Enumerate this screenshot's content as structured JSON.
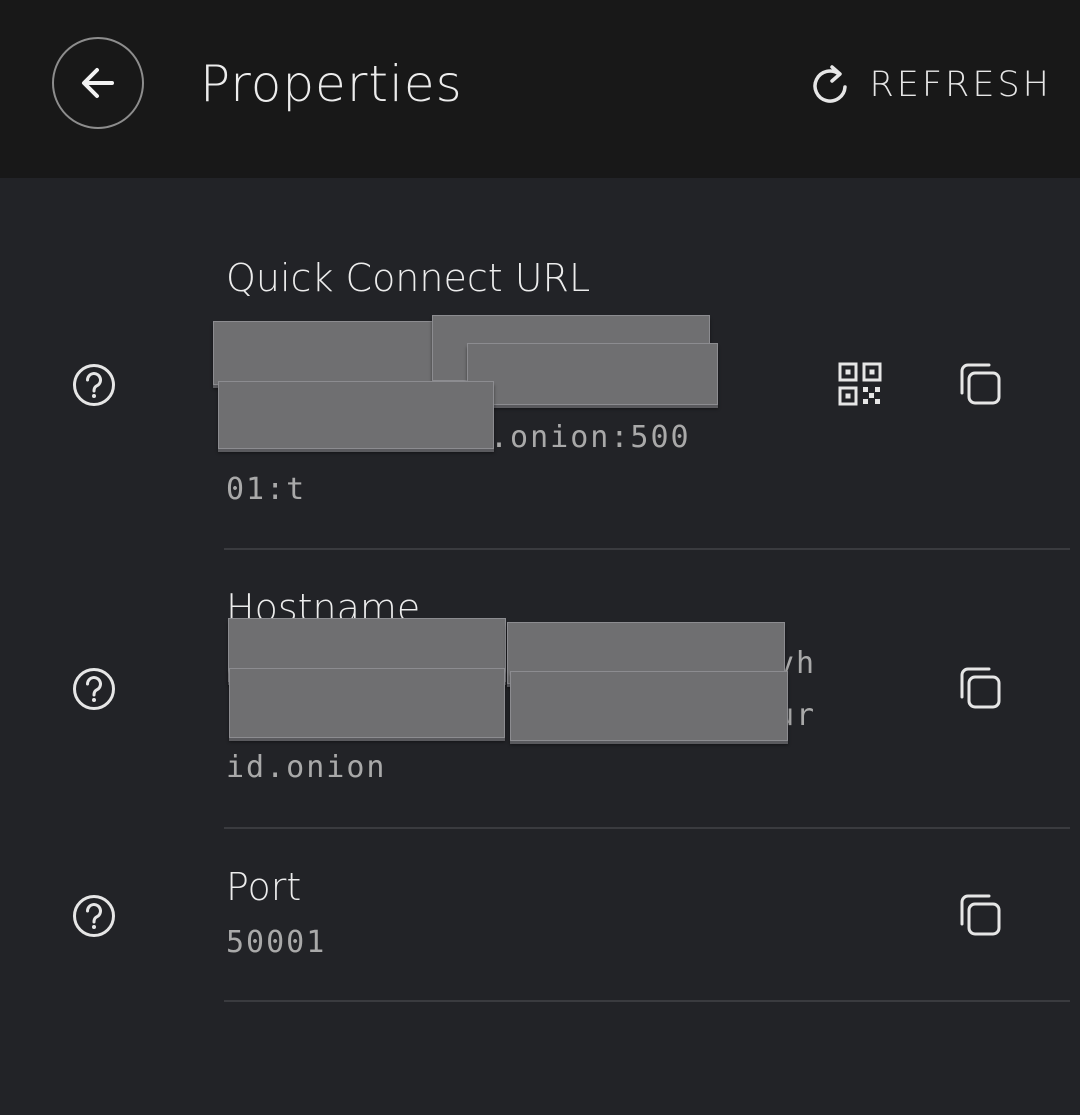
{
  "header": {
    "title": "Properties",
    "refresh_label": "REFRESH",
    "back_icon": "arrow-left-icon",
    "refresh_icon": "refresh-icon"
  },
  "properties": [
    {
      "label": "Quick Connect URL",
      "value_line_1": ".onion:500",
      "value_line_2": "01:t",
      "actions": [
        "qr-code-icon",
        "copy-icon"
      ]
    },
    {
      "label": "Hostname",
      "value_line_1": "vh",
      "value_line_2": "ur",
      "value_line_3": "id.onion",
      "actions": [
        "copy-icon"
      ]
    },
    {
      "label": "Port",
      "value_line_1": "50001",
      "actions": [
        "copy-icon"
      ]
    }
  ],
  "colors": {
    "header_bg": "#181818",
    "page_bg": "#222327",
    "text_primary": "#ececec",
    "text_secondary": "#a9a9a9",
    "redaction": "#6f6f71"
  }
}
